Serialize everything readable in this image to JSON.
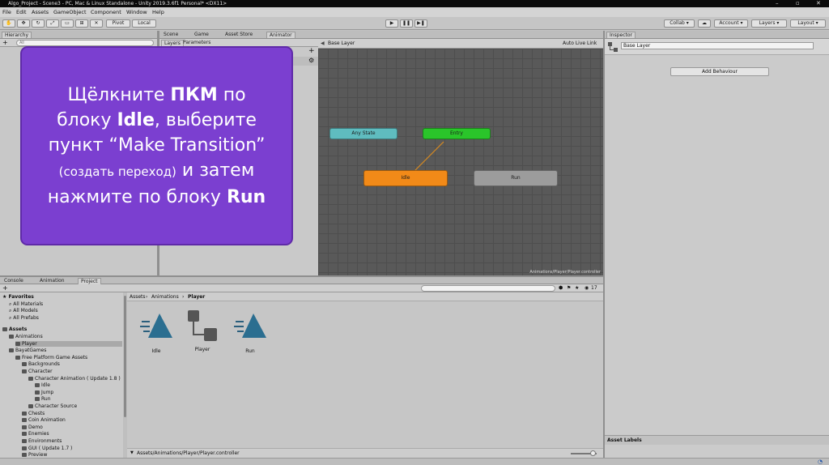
{
  "titlebar": {
    "text": "Algo_Project - Scene3 - PC, Mac & Linux Standalone - Unity 2019.3.6f1 Personal* <DX11>"
  },
  "menu": [
    "File",
    "Edit",
    "Assets",
    "GameObject",
    "Component",
    "Window",
    "Help"
  ],
  "toolbar": {
    "pivot": "Pivot",
    "local": "Local",
    "play": "▶",
    "pause": "❚❚",
    "step": "▶❚",
    "collab": "Collab ▾",
    "cloud": "☁",
    "account": "Account ▾",
    "layers": "Layers ▾",
    "layout": "Layout ▾"
  },
  "hierarchy": {
    "tab": "Hierarchy",
    "search_placeholder": "All"
  },
  "center_tabs": [
    "Scene",
    "Game",
    "Asset Store",
    "Animator"
  ],
  "animator": {
    "sub_tabs": [
      "Layers",
      "Parameters"
    ],
    "breadcrumb": "Base Layer",
    "auto_live": "Auto Live Link",
    "footer_path": "Animations/Player/Player.controller",
    "states": [
      {
        "id": "any-state",
        "label": "Any State",
        "color": "#5fbcbf"
      },
      {
        "id": "entry",
        "label": "Entry",
        "color": "#2ac52a"
      },
      {
        "id": "idle",
        "label": "Idle",
        "color": "#f28a18"
      },
      {
        "id": "run",
        "label": "Run",
        "color": "#9c9c9c"
      }
    ]
  },
  "inspector": {
    "tab": "Inspector",
    "layer_name": "Base Layer",
    "add_behaviour": "Add Behaviour",
    "asset_labels": "Asset Labels"
  },
  "overlay": {
    "line1_a": "Щёлкните ",
    "line1_b": "ПКМ",
    "line1_c": " по",
    "line2_a": "блоку ",
    "line2_b": "Idle",
    "line2_c": ", выберите",
    "line3": "пункт “Make Transition”",
    "line4_small": "(создать переход)",
    "line4_rest": " и затем",
    "line5_a": "нажмите по блоку ",
    "line5_b": "Run"
  },
  "bottom_tabs": [
    "Console",
    "Animation",
    "Project"
  ],
  "project": {
    "count": "17",
    "breadcrumb": [
      "Assets",
      "Animations",
      "Player"
    ],
    "favorites": {
      "title": "Favorites",
      "items": [
        "All Materials",
        "All Models",
        "All Prefabs"
      ]
    },
    "tree": [
      {
        "label": "Assets",
        "indent": 0,
        "bold": true
      },
      {
        "label": "Animations",
        "indent": 1
      },
      {
        "label": "Player",
        "indent": 2,
        "selected": true
      },
      {
        "label": "BayatGames",
        "indent": 1
      },
      {
        "label": "Free Platform Game Assets",
        "indent": 2
      },
      {
        "label": "Backgrounds",
        "indent": 3
      },
      {
        "label": "Character",
        "indent": 3
      },
      {
        "label": "Character Animation ( Update 1.8 )",
        "indent": 4
      },
      {
        "label": "Idle",
        "indent": 5
      },
      {
        "label": "Jump",
        "indent": 5
      },
      {
        "label": "Run",
        "indent": 5
      },
      {
        "label": "Character Source",
        "indent": 4
      },
      {
        "label": "Chests",
        "indent": 3
      },
      {
        "label": "Coin Animation",
        "indent": 3
      },
      {
        "label": "Demo",
        "indent": 3
      },
      {
        "label": "Enemies",
        "indent": 3
      },
      {
        "label": "Environments",
        "indent": 3
      },
      {
        "label": "GUI ( Update 1.7 )",
        "indent": 3
      },
      {
        "label": "Preview",
        "indent": 3
      }
    ],
    "assets": [
      {
        "label": "Idle",
        "icon": "animation-clip-icon"
      },
      {
        "label": "Player",
        "icon": "animator-controller-icon"
      },
      {
        "label": "Run",
        "icon": "animation-clip-icon"
      }
    ],
    "footer_path": "Assets/Animations/Player/Player.controller"
  }
}
